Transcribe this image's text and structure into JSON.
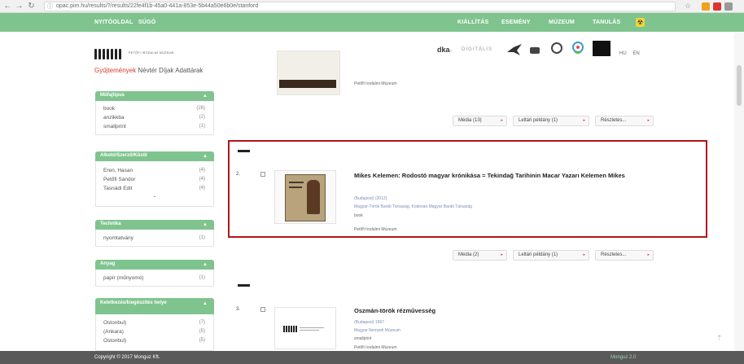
{
  "browser": {
    "address": "opac.pim.hu/results/?/results/22fe4f1b-45a0-441a-853e-5b44a50e6b0e/stanford",
    "ext_colors": [
      "#f0a020",
      "#dd3333",
      "#999999"
    ]
  },
  "topnav": {
    "left": [
      "NYITÓOLDAL",
      "SÚGÓ"
    ],
    "right": [
      "KIÁLLÍTÁS",
      "ESEMÉNY",
      "MÚZEUM",
      "TANULÁS"
    ]
  },
  "logo": {
    "text": "PETŐFI IRODALMI MÚZEUM"
  },
  "subnav": {
    "items": [
      "Gyűjtemények",
      "Névtér",
      "Díjak",
      "Adattárak"
    ]
  },
  "partners": [
    "dka",
    "DIGITÁLIS",
    "HU",
    "EN"
  ],
  "facets": [
    {
      "title": "Műfajtípus",
      "rows": [
        {
          "label": "book",
          "count": "(26)"
        },
        {
          "label": "anzikkba",
          "count": "(2)"
        },
        {
          "label": "smallprint",
          "count": "(1)"
        }
      ]
    },
    {
      "title": "Alkotó/Szerző/Közöl",
      "rows": [
        {
          "label": "Eren, Hasan",
          "count": "(4)"
        },
        {
          "label": "Petőfi Sándor",
          "count": "(4)"
        },
        {
          "label": "Tasnádi Edit",
          "count": "(4)"
        }
      ]
    },
    {
      "title": "Technika",
      "rows": [
        {
          "label": "nyomtatvány",
          "count": "(1)"
        }
      ]
    },
    {
      "title": "Anyag",
      "rows": [
        {
          "label": "papír (műnyomó)",
          "count": "(1)"
        }
      ]
    },
    {
      "title": "Keletkezés/kiegészítés helye",
      "rows": [
        {
          "label": "Ostonbul)",
          "count": "(7)"
        },
        {
          "label": "(Ankara)",
          "count": "(5)"
        },
        {
          "label": "Ostonbul)",
          "count": "(5)"
        }
      ]
    }
  ],
  "results": [
    {
      "index": "",
      "title": "",
      "meta1": "",
      "meta2": "",
      "owner": "Petőfi Irodalmi Múzeum",
      "buttons": [
        "Média (13)",
        "Leltári példány (1)",
        "Részletes..."
      ]
    },
    {
      "index": "2.",
      "title": "Mikes Kelemen: Rodostó magyar krónikása = Tekindağ Tarihinin Macar Yazarı Kelemen Mikes",
      "meta1": "(Budapest) (2012)",
      "meta2": "Magyar-Török Baráti Társaság, Kodovan Magyar Baráti Társaság",
      "type": "book",
      "owner": "Petőfi Irodalmi Múzeum",
      "buttons": [
        "Média (2)",
        "Leltári példány (1)",
        "Részletes..."
      ]
    },
    {
      "index": "3.",
      "title": "Oszmán-török rézművesség",
      "meta1": "(Budapest) 1997",
      "meta2": "Magyar Nemzeti Múzeum",
      "type": "smallprint",
      "owner": "Petőfi Irodalmi Múzeum",
      "buttons": []
    }
  ],
  "footer": {
    "copyright": "Copyright © 2017 Monguz Kft.",
    "right": "Monguz 2.0"
  }
}
